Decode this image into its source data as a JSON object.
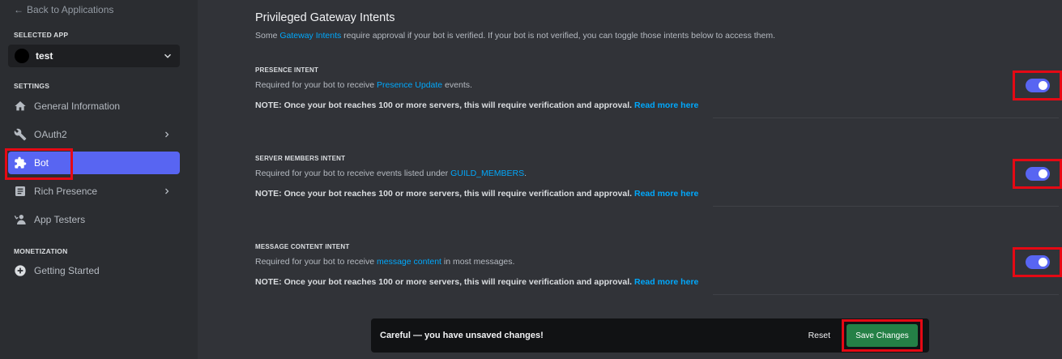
{
  "sidebar": {
    "back_label": "Back to Applications",
    "selected_app_heading": "SELECTED APP",
    "app_name": "test",
    "settings_heading": "SETTINGS",
    "items": [
      {
        "label": "General Information"
      },
      {
        "label": "OAuth2"
      },
      {
        "label": "Bot"
      },
      {
        "label": "Rich Presence"
      },
      {
        "label": "App Testers"
      }
    ],
    "monetization_heading": "MONETIZATION",
    "monetization_items": [
      {
        "label": "Getting Started"
      }
    ]
  },
  "main": {
    "title": "Privileged Gateway Intents",
    "desc_before": "Some ",
    "desc_link": "Gateway Intents",
    "desc_after": " require approval if your bot is verified. If your bot is not verified, you can toggle those intents below to access them.",
    "intents": [
      {
        "heading": "PRESENCE INTENT",
        "desc_before": "Required for your bot to receive ",
        "desc_link": "Presence Update",
        "desc_after": " events.",
        "note": "NOTE: Once your bot reaches 100 or more servers, this will require verification and approval.",
        "note_link": "Read more here",
        "enabled": true
      },
      {
        "heading": "SERVER MEMBERS INTENT",
        "desc_before": "Required for your bot to receive events listed under ",
        "desc_link": "GUILD_MEMBERS",
        "desc_after": ".",
        "note": "NOTE: Once your bot reaches 100 or more servers, this will require verification and approval.",
        "note_link": "Read more here",
        "enabled": true
      },
      {
        "heading": "MESSAGE CONTENT INTENT",
        "desc_before": "Required for your bot to receive ",
        "desc_link": "message content",
        "desc_after": " in most messages.",
        "note": "NOTE: Once your bot reaches 100 or more servers, this will require verification and approval.",
        "note_link": "Read more here",
        "enabled": true
      }
    ]
  },
  "save_bar": {
    "message": "Careful — you have unsaved changes!",
    "reset_label": "Reset",
    "save_label": "Save Changes"
  },
  "colors": {
    "accent": "#5865f2",
    "link": "#00a8fc",
    "save": "#248046",
    "highlight": "#e50914"
  }
}
